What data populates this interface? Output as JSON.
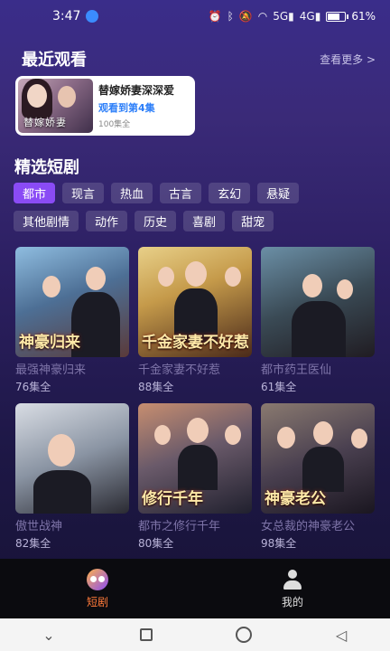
{
  "status_bar": {
    "time": "3:47",
    "icons": [
      "alarm-icon",
      "bluetooth-icon",
      "mute-icon",
      "wifi-icon",
      "signal-5g-icon",
      "signal-4g-icon",
      "battery-icon"
    ],
    "signal_5g": "5G",
    "signal_4g": "4G",
    "battery_percent": "61%",
    "battery_level": 0.61
  },
  "recent": {
    "title": "最近观看",
    "see_more": "查看更多 >",
    "item": {
      "poster_caption": "替嫁娇妻",
      "title": "替嫁娇妻深深爱",
      "progress": "观看到第4集",
      "episodes": "100集全"
    }
  },
  "featured": {
    "title": "精选短剧",
    "tags_row1": [
      "都市",
      "现言",
      "热血",
      "古言",
      "玄幻",
      "悬疑"
    ],
    "tags_row2": [
      "其他剧情",
      "动作",
      "历史",
      "喜剧",
      "甜宠"
    ],
    "active_tag": "都市",
    "dramas": [
      {
        "title": "最强神豪归来",
        "episodes": "76集全",
        "poster_text": "神豪归来"
      },
      {
        "title": "千金家妻不好惹",
        "episodes": "88集全",
        "poster_text": "千金家妻不好惹"
      },
      {
        "title": "都市药王医仙",
        "episodes": "61集全",
        "poster_text": ""
      },
      {
        "title": "傲世战神",
        "episodes": "82集全",
        "poster_text": ""
      },
      {
        "title": "都市之修行千年",
        "episodes": "80集全",
        "poster_text": "修行千年"
      },
      {
        "title": "女总裁的神豪老公",
        "episodes": "98集全",
        "poster_text": "神豪老公"
      }
    ]
  },
  "bottom_nav": {
    "items": [
      {
        "label": "短剧",
        "icon": "drama-icon",
        "active": true
      },
      {
        "label": "我的",
        "icon": "user-icon",
        "active": false
      }
    ],
    "active_color": "#ff7a3a"
  },
  "system_nav": {
    "icons": [
      "back-chevron-icon",
      "recents-square-icon",
      "home-circle-icon",
      "back-triangle-icon"
    ]
  },
  "colors": {
    "active_tag": "#8a4bf5",
    "progress_text": "#2d7ff9",
    "background_top": "#3a2d8a",
    "background_bottom": "#161233"
  }
}
